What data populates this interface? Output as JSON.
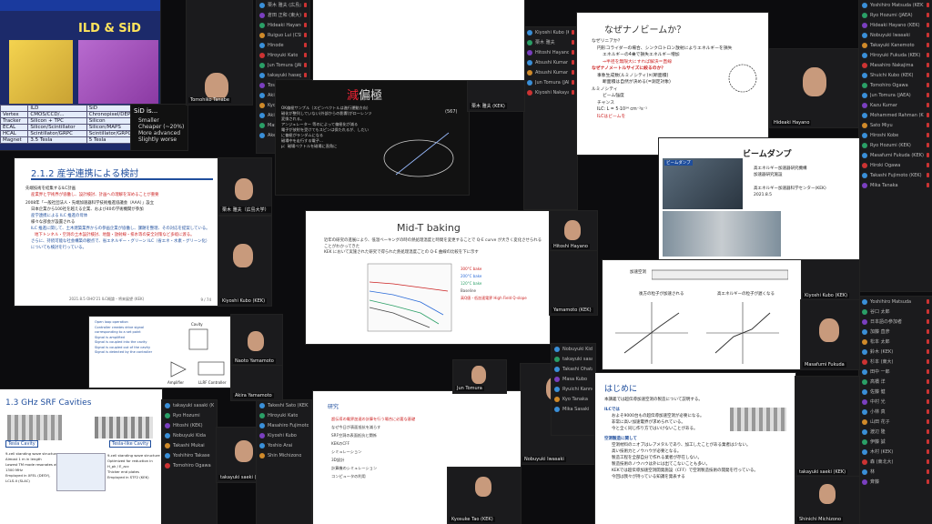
{
  "slides": {
    "ild": {
      "title": "ILD & SiD",
      "table_header": [
        "",
        "ILD",
        "SiD"
      ],
      "table_rows": [
        [
          "Vertex",
          "CMOS/CCD/...",
          "Chronopixel/DEPFET/..."
        ],
        [
          "Tracker",
          "Silicon + TPC",
          "Silicon"
        ],
        [
          "ECAL",
          "Silicon/Scintillator",
          "Silicon/MAPS"
        ],
        [
          "HCAL",
          "Scintillator/GRPC",
          "Scintillator/GRPC"
        ],
        [
          "Magnet",
          "3.5 Tesla",
          "5 Tesla"
        ]
      ],
      "side_title": "SiD is...",
      "side_items": [
        "Smaller",
        "Cheaper (~20%)",
        "More advanced",
        "Slightly worse"
      ]
    },
    "sangaku": {
      "title": "2.1.2 産学連携による検討",
      "lines": [
        "先端技術を結集するILC計画",
        "産業界と学術界が協働し、設計検討、計画への理解を深めることが重要",
        "2008年「一般社団法人・先端加速器科学技術推進協議会（AAA）」設立",
        "日本企業から100社を越える企業、および40の学術機関が参加",
        "産学連携による ILC 推進の母体",
        "様々な部会が設置される",
        "ILC 推進に関して、土木建築業界からの参画企業が協働し、課題を整理、その対応を提案している。",
        "地下トンネル・空洞の土木設計検討、地盤・放射線・排水等の安全対策など多岐に渡る。",
        "さらに、持続可能な社会構築の観点で、省エネルギー・グリーン ILC（省エネ・水素・グリーン化）についても検討を行っている。"
      ],
      "footer": "2021.8.5  OHO'21  ILC概論・将来展望 (KEK)",
      "page": "9 / 74"
    },
    "genpen": {
      "title_red": "減",
      "title": "偏極",
      "bullets": [
        "OK偏極サンプル（スピンベクトルは進行運動方向）",
        "磁化が整列していない(外部からの影響)がローレンツ変換される。",
        "アンジュレーター 等のによって偏極化が減る",
        "電子が放射を受けてもスピンは保たれるが、しだいに偏極がランダムになる",
        "磁場中を走行する電子…",
        "μ：磁場ベクトルを磁場に直角に"
      ],
      "eq": "(567)"
    },
    "nano": {
      "title": "なぜナノビームか？",
      "items": [
        "なぜリニアか？",
        "円形コライダーの場合、シンクロトロン放射によりエネルギーを損失",
        "エネルギーの4乗で損失エネルギー増加",
        "⇒半径を無限大にすれば解決＝直線",
        "なぜナノメートルサイズに絞るのか？",
        "事象生成数(ルミノシティ)×(断面積)",
        "断面積は自然が決める(=測定対象)",
        "ルミノシティ",
        "ビーム強度",
        "チャンス",
        " ILC: L = 5·10³⁴ cm⁻²s⁻¹",
        "ILCはビームを"
      ]
    },
    "dump": {
      "title": "ビームダンプ",
      "caption1": "高エネルギー加速器研究機構",
      "caption2": "加速器研究施設",
      "caption3": "高エネルギー加速器科学センター(KEK)",
      "date": "2021.8.5",
      "photo_label": "ビームダンプ"
    },
    "midt": {
      "title": "Mid-T baking",
      "bullets": [
        "近年の研究の進展により、低温ベーキングの時の熱処理温度と時間を変更することで Q-E curve が大きく変化させられることがわかってきた",
        "KEK において実施された研究で得られた熱処理温度ごとの Q-E 曲線の比較を下に示す"
      ],
      "legend": [
        "300°C bake",
        "200°C bake",
        "120°C bake",
        "Baseline"
      ],
      "note": "高Q値・低加速電界 High Field Q-slope"
    },
    "srf": {
      "title": "1.3 GHz SRF Cavities",
      "label_a": "Tesla Cavity",
      "label_b": "Tesla-like Cavity",
      "list_a": [
        "9-cell standing wave structure",
        "Almost 1 m in length",
        "Lowest TM mode resonates at 1300 MHz",
        "Employed in XFEL (DESY), LCLS-II (SLAC)"
      ],
      "list_b": [
        "9-cell standing wave structure",
        "Optimized for reduction in H_pk / E_acc",
        "Thicker end plates",
        "Employed in STF2 (KEK)"
      ]
    },
    "rf": {
      "bullets": [
        "Open loop operation",
        "Controller creates drive signal corresponding to a set point",
        "Signal is amplified",
        "Signal is coupled into the cavity",
        "Signal is coupled out of the cavity",
        "Signal is detected by the controller"
      ],
      "cavity": "Cavity",
      "amp": "Amplifier",
      "ctrl": "LLRF Controller"
    },
    "dip": {
      "label1": "後方の粒子が加速される",
      "label2": "高エネルギーの粒子が遅くなる",
      "label3": "加速空洞"
    },
    "hajime": {
      "title": "はじめに",
      "intro": "本講義では超伝導加速空洞の製造について説明する。",
      "head1": "ILCでは",
      "b1": [
        "およそ9000台もの超伝導加速空洞が必要になる。",
        "非常に高い加速電界が求められている。",
        "今と全く同じ作り方ではいけないことがある。"
      ],
      "head2": "空洞製造に関して",
      "b2": [
        "空洞材料のニオブはレアメタルであり、加工したことがある業者は少ない。",
        "高い技術力とノウハウが必要となる。",
        "製造工程を全部自分で作れる業者が存在しない。",
        "製造技術のノウハウは外には出てこないことも多い。",
        "KEKでは超伝導加速空洞開発施設（CFF）で空洞製造技術の開発を行っている。",
        "今回は我々が持っている知識を発表する"
      ]
    },
    "kenshu": {
      "title": "研究",
      "lines": [
        "超伝導の電界加速の計算を行う場合に必要な基礎",
        "なぜ今日が表面抵抗を減らす",
        "SRF空洞の表面抵抗と関係",
        "KEKのCFF",
        "シミュレーション",
        "3D設計",
        "計算機のシミュレーション",
        "コンピュータの利用"
      ]
    }
  },
  "participants": {
    "list_a": [
      "栗木 雅夫 (広島大学)",
      "倉田 正和 (東大)",
      "Hideaki Hayano",
      "Ruiguo Lui (CSIRO)",
      "Hinode",
      "Hiroyuki Kato",
      "Jun Tomura (JAEA)",
      "takayuki hasegawa",
      "Toshiki Kunoyama",
      "Aki Sasaki",
      "Kyosuke Tao",
      "Akiyoshi Takahashi",
      "Masafumi Fukuda (KEK)",
      "Akemitsu Shinei",
      "Nobuyuki Iwasaki",
      "ひらがな名前",
      "Ohata",
      "Ohshima"
    ],
    "list_b": [
      "Kiyoshi Kubo (KEK)",
      "栗木 雅夫",
      "Hitoshi Hayano (KEK)",
      "Atsushi Kumar",
      "Atsushi Kumar (KEK)",
      "Jun Tomura (JAEA)",
      "Kiyoshi Nakayama"
    ],
    "list_c": [
      "Yoshihiro Matsuda (KEK)",
      "Ryo Hozumi (JAEA)",
      "Hideaki Hayano (KEK)",
      "Nobuyuki Iwasaki",
      "Takayuki Kanemoto",
      "Hiroyuki Fukuda (KEK)",
      "Masahiro Nakajima",
      "Shuichi Kubo (KEK)",
      "Tomohiro Ogawa",
      "Jun Tomura (JAEA)",
      "Kazu Kumar",
      "Mohammed Rahman (KEK)",
      "Sato Miyu",
      "Hiroshi Kobe",
      "Ryo Hozumi (KEK)",
      "Masafumi Fukuda (KEK)",
      "Hiroki Ogawa",
      "Takashi Fujimoto (KEK)",
      "Mika Tanaka"
    ],
    "list_d": [
      "Yoshihiro Matsuda",
      "谷口 太郎",
      "日本語の参加者",
      "加藤 直彦",
      "松本 太郎",
      "鈴木 (KEK)",
      "杉本 (東大)",
      "田中 一郎",
      "高橋 洋",
      "佐藤 健",
      "中村 光",
      "小林 真",
      "山田 花子",
      "渡辺 隆",
      "伊藤 誠",
      "木村 (KEK)",
      "森 (東北大)",
      "林",
      "斉藤"
    ],
    "list_e": [
      "takayuki sasaki (KEK)",
      "Ryo Hozumi",
      "Hitoshi (KEK)",
      "Nobuyuki Kida",
      "Takashi Mukai",
      "Yoshihiro Takase",
      "Tomohiro Ogawa"
    ],
    "list_f": [
      "Takeshi Sato (KEK)",
      "Hiroyuki Kato",
      "Masahiro Fujimoto",
      "Kiyoshi Kubo",
      "Yoshio Arai",
      "Shin Michizono"
    ],
    "list_g": [
      "Nobuyuki Kida (KEK)",
      "takayuki sasaki",
      "Takashi Ohata",
      "Masa Kubo",
      "Ryuichi Kanno",
      "Kyo Tanaka",
      "Mika Sasaki"
    ]
  },
  "video_labels": {
    "v1": "Tomohiko Tanabe",
    "v2": "栗木 雅夫（広島大学）",
    "v3": "Kiyoshi Kubo (KEK)",
    "v4": "Naoto Yamamoto",
    "v5": "takayuki saeki (KEK)",
    "v6": "Hitoshi Hayano",
    "v7": "栗木 雅夫 (KEK)",
    "v8": "Hideaki Hayano",
    "v9": "Masafumi Fukuda",
    "v10": "Nobuyuki Iwasaki",
    "v11": "Jun Tomura",
    "v12": "takayuki saeki (KEK)",
    "v13": "Shinichi Michizono",
    "v14": "Akira Yamamoto",
    "v15": "Kyosuke Tao (KEK)",
    "v16": "Yamamoto (KEK)"
  },
  "colors": {
    "accent_blue": "#1f4e9d",
    "red": "#d32f2f",
    "bg": "#0c0c0e"
  }
}
